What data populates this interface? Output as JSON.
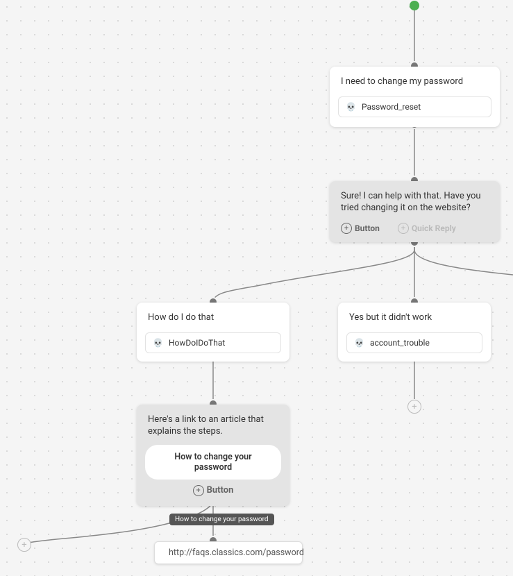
{
  "start": {
    "icon": "start-dot"
  },
  "nodes": {
    "user_pw": {
      "title": "I need to change my password",
      "intent_icon": "skull-icon",
      "intent_name": "Password_reset"
    },
    "bot_sure": {
      "text": "Sure! I can help with that. Have you tried changing it on the website?",
      "action_button": "Button",
      "action_quick": "Quick Reply"
    },
    "user_how": {
      "title": "How do I do that",
      "intent_icon": "skull-icon",
      "intent_name": "HowDoIDoThat"
    },
    "user_yes": {
      "title": "Yes but it didn't work",
      "intent_icon": "skull-icon",
      "intent_name": "account_trouble"
    },
    "bot_link": {
      "text": "Here's a link to an article that explains the steps.",
      "button_label": "How to change your password",
      "action_button": "Button"
    }
  },
  "link_tag": "How to change your password",
  "url_box": {
    "icon": "external-link-icon",
    "url": "http://faqs.classics.com/password"
  },
  "colors": {
    "start": "#4caf50",
    "node_gray": "#e4e4e4",
    "port": "#777"
  }
}
